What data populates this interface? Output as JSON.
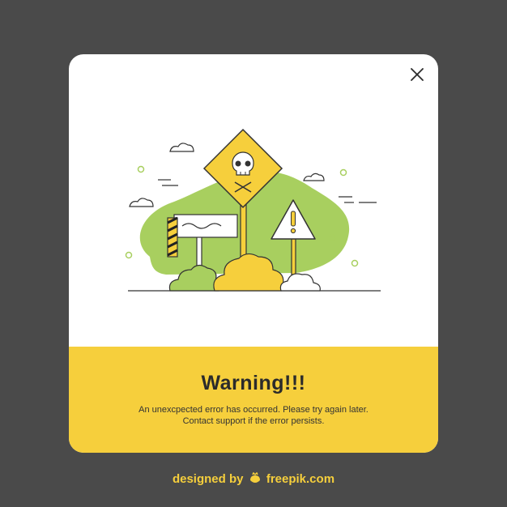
{
  "dialog": {
    "title": "Warning!!!",
    "message_line1": "An unexcpected error has occurred. Please try again later.",
    "message_line2": "Contact support if the error persists."
  },
  "credit": {
    "prefix": "designed by",
    "brand": "freepik.com"
  },
  "colors": {
    "background": "#4a4a4a",
    "dialog": "#ffffff",
    "accent_yellow": "#f6cf3c",
    "blob_green": "#a8cf5f",
    "text": "#2b2b2b"
  },
  "icons": {
    "close": "close-icon",
    "skull_sign": "skull-warning-sign",
    "exclamation_sign": "exclamation-triangle-sign",
    "credit_logo": "freepik-logo-icon"
  }
}
